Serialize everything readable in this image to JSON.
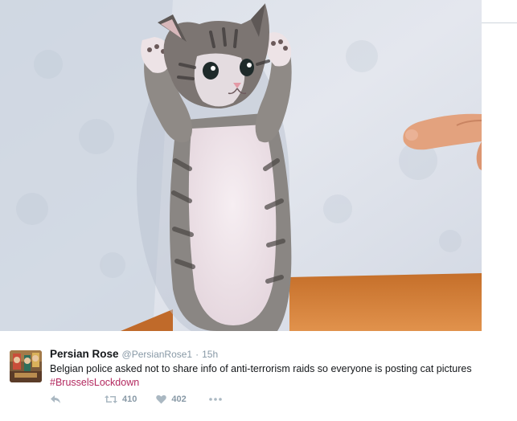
{
  "tweet": {
    "display_name": "Persian Rose",
    "handle": "@PersianRose1",
    "separator": "·",
    "timestamp": "15h",
    "text": "Belgian police asked not to share info of anti-terrorism raids so everyone is posting cat pictures",
    "hashtag": "#BrusselsLockdown"
  },
  "actions": {
    "reply_icon": "reply-icon",
    "retweet_icon": "retweet-icon",
    "retweet_count": "410",
    "like_icon": "heart-icon",
    "like_count": "402",
    "more_icon": "more-icon"
  },
  "colors": {
    "hashtag": "#b3295f",
    "meta_text": "#8899a6",
    "icon": "#aab8c2"
  }
}
